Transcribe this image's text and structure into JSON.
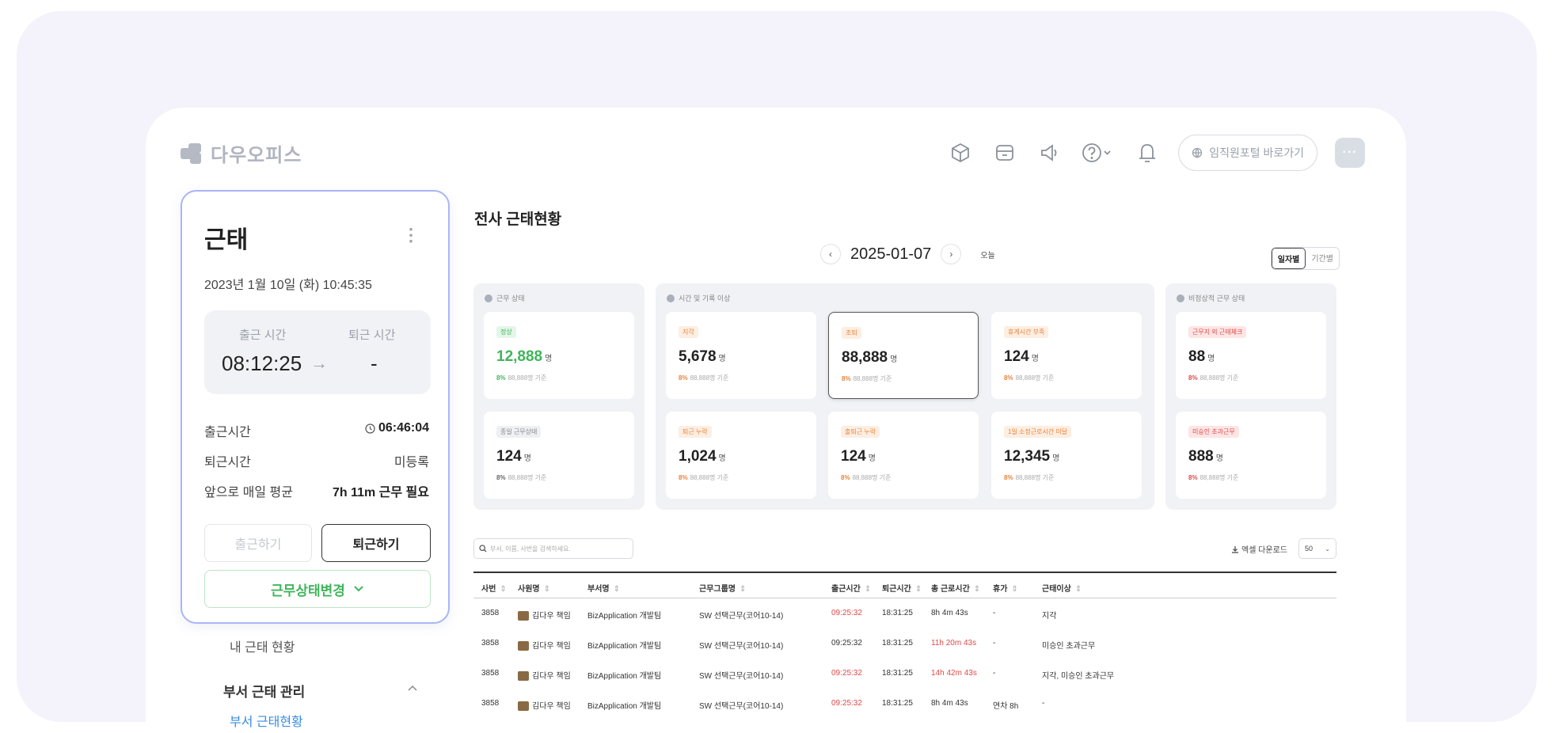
{
  "header": {
    "logo_text": "다우오피스",
    "portal_label": "임직원포털 바로가기",
    "more_label": "···"
  },
  "attendance": {
    "title": "근태",
    "datetime": "2023년 1월 10일 (화) 10:45:35",
    "clock_in_label": "출근 시간",
    "clock_out_label": "퇴근 시간",
    "clock_in_value": "08:12:25",
    "clock_out_value": "-",
    "rows": [
      {
        "label": "출근시간",
        "value": "06:46:04"
      },
      {
        "label": "퇴근시간",
        "value": "미등록"
      },
      {
        "label": "앞으로 매일 평균",
        "value": "7h 11m 근무 필요"
      }
    ],
    "btn_in": "출근하기",
    "btn_out": "퇴근하기",
    "btn_status": "근무상태변경"
  },
  "sidebar": {
    "my_status": "내 근태 현황",
    "dept_mgmt": "부서 근태 관리",
    "dept_status": "부서 근태현황"
  },
  "main": {
    "title": "전사 근태현황",
    "date": "2025-01-07",
    "today": "오늘",
    "seg_daily": "일자별",
    "seg_period": "기간별"
  },
  "groups": [
    {
      "label": "근무 상태"
    },
    {
      "label": "시간 및 기록 이상"
    },
    {
      "label": "비정상적 근무 상태"
    }
  ],
  "stats": [
    {
      "badge": "정상",
      "num": "12,888",
      "unit": "명",
      "pct": "8%",
      "base": "88,888명 기준"
    },
    {
      "badge": "종일 근무상태",
      "num": "124",
      "unit": "명",
      "pct": "8%",
      "base": "88,888명 기준"
    },
    {
      "badge": "지각",
      "num": "5,678",
      "unit": "명",
      "pct": "8%",
      "base": "88,888명 기준"
    },
    {
      "badge": "조퇴",
      "num": "88,888",
      "unit": "명",
      "pct": "8%",
      "base": "88,888명 기준"
    },
    {
      "badge": "휴게시간 부족",
      "num": "124",
      "unit": "명",
      "pct": "8%",
      "base": "88,888명 기준"
    },
    {
      "badge": "퇴근 누락",
      "num": "1,024",
      "unit": "명",
      "pct": "8%",
      "base": "88,888명 기준"
    },
    {
      "badge": "출퇴근 누락",
      "num": "124",
      "unit": "명",
      "pct": "8%",
      "base": "88,888명 기준"
    },
    {
      "badge": "1일 소정근로시간 미달",
      "num": "12,345",
      "unit": "명",
      "pct": "8%",
      "base": "88,888명 기준"
    },
    {
      "badge": "근무지 외 근태체크",
      "num": "88",
      "unit": "명",
      "pct": "8%",
      "base": "88,888명 기준"
    },
    {
      "badge": "미승인 초과근무",
      "num": "888",
      "unit": "명",
      "pct": "8%",
      "base": "88,888명 기준"
    }
  ],
  "toolbar": {
    "search_placeholder": "부서, 이름, 사번을 검색하세요.",
    "excel": "엑셀 다운로드",
    "page_size": "50"
  },
  "table": {
    "headers": [
      "사번",
      "사원명",
      "부서명",
      "근무그룹명",
      "출근시간",
      "퇴근시간",
      "총 근로시간",
      "휴가",
      "근태이상"
    ],
    "rows": [
      [
        "3858",
        "김다우 책임",
        "BizApplication 개발팀",
        "SW 선택근무(코어10-14)",
        "09:25:32",
        "18:31:25",
        "8h 4m 43s",
        "-",
        "지각"
      ],
      [
        "3858",
        "김다우 책임",
        "BizApplication 개발팀",
        "SW 선택근무(코어10-14)",
        "09:25:32",
        "18:31:25",
        "11h 20m 43s",
        "-",
        "미승인 초과근무"
      ],
      [
        "3858",
        "김다우 책임",
        "BizApplication 개발팀",
        "SW 선택근무(코어10-14)",
        "09:25:32",
        "18:31:25",
        "14h 42m 43s",
        "-",
        "지각, 미승인 초과근무"
      ],
      [
        "3858",
        "김다우 책임",
        "BizApplication 개발팀",
        "SW 선택근무(코어10-14)",
        "09:25:32",
        "18:31:25",
        "8h 4m 43s",
        "연차 8h",
        "-"
      ]
    ]
  },
  "colors": {
    "accent_green": "#3fb55a",
    "alert_red": "#e04848",
    "warn_orange": "#e8833a",
    "card_border": "#a8b6f6"
  }
}
